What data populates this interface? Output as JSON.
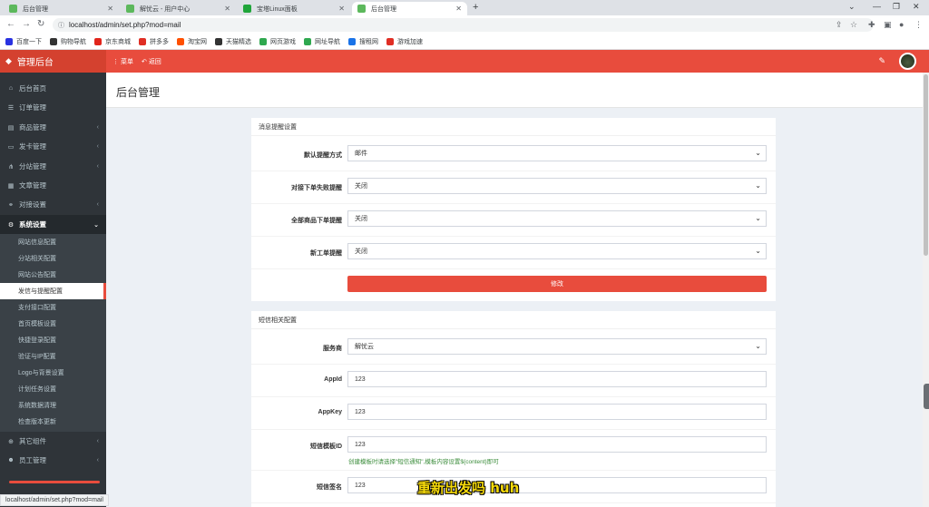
{
  "browser": {
    "tabs": [
      {
        "title": "后台管理",
        "color": "#5cb85c"
      },
      {
        "title": "解忧云 - 用户中心",
        "color": "#5cb85c"
      },
      {
        "title": "宝塔Linux面板",
        "color": "#20a53a"
      },
      {
        "title": "后台管理",
        "color": "#5cb85c"
      }
    ],
    "new_tab": "+",
    "close": "✕",
    "url": "localhost/admin/set.php?mod=mail",
    "bookmarks": [
      {
        "label": "百度一下",
        "color": "#2932e1"
      },
      {
        "label": "购物导航",
        "color": "#333333"
      },
      {
        "label": "京东商城",
        "color": "#e1251b"
      },
      {
        "label": "拼多多",
        "color": "#e02e24"
      },
      {
        "label": "淘宝网",
        "color": "#ff5000"
      },
      {
        "label": "天猫精选",
        "color": "#333333"
      },
      {
        "label": "网页游戏",
        "color": "#2fa84f"
      },
      {
        "label": "网址导航",
        "color": "#2fa84f"
      },
      {
        "label": "搜租网",
        "color": "#1a73e8"
      },
      {
        "label": "游戏加速",
        "color": "#e02e24"
      }
    ],
    "status_url": "localhost/admin/set.php?mod=mail"
  },
  "app": {
    "brand": "管理后台",
    "menu_btn": "菜单",
    "back_btn": "返回",
    "accent": "#e84c3d"
  },
  "sidebar": {
    "items": [
      {
        "label": "后台首页",
        "icon": "home-icon"
      },
      {
        "label": "订单管理",
        "icon": "list-icon"
      },
      {
        "label": "商品管理",
        "icon": "box-icon",
        "arrow": "‹"
      },
      {
        "label": "发卡管理",
        "icon": "card-icon",
        "arrow": "‹"
      },
      {
        "label": "分站管理",
        "icon": "sitemap-icon",
        "arrow": "‹"
      },
      {
        "label": "文章管理",
        "icon": "doc-icon"
      },
      {
        "label": "对接设置",
        "icon": "link-icon",
        "arrow": "‹"
      },
      {
        "label": "系统设置",
        "icon": "gear-icon",
        "arrow": "⌄"
      }
    ],
    "sub_items": [
      "网站信息配置",
      "分站相关配置",
      "网站公告配置",
      "发信与提醒配置",
      "支付接口配置",
      "首页模板设置",
      "快捷登录配置",
      "验证与IP配置",
      "Logo与背景设置",
      "计划任务设置",
      "系统数据清理",
      "检查版本更新"
    ],
    "active_sub": 3,
    "bottom_items": [
      {
        "label": "其它组件",
        "icon": "plugin-icon",
        "arrow": "‹"
      },
      {
        "label": "员工管理",
        "icon": "user-icon",
        "arrow": "‹"
      }
    ]
  },
  "page": {
    "title": "后台管理"
  },
  "panel1": {
    "title": "消息提醒设置",
    "rows": [
      {
        "label": "默认提醒方式",
        "value": "邮件"
      },
      {
        "label": "对接下单失败提醒",
        "value": "关闭"
      },
      {
        "label": "全部商品下单提醒",
        "value": "关闭"
      },
      {
        "label": "新工单提醒",
        "value": "关闭"
      }
    ],
    "submit": "修改"
  },
  "panel2": {
    "title": "短信相关配置",
    "rows": [
      {
        "label": "服务商",
        "value": "解忧云",
        "type": "select"
      },
      {
        "label": "AppId",
        "value": "123",
        "type": "input"
      },
      {
        "label": "AppKey",
        "value": "123",
        "type": "input"
      },
      {
        "label": "短信模板ID",
        "value": "123",
        "type": "input",
        "help": "创建模板时请选择\"短信通知\",模板内容设置${content}即可"
      },
      {
        "label": "短信签名",
        "value": "123",
        "type": "input"
      }
    ]
  },
  "overlay_caption": "重新出发吗 huh"
}
